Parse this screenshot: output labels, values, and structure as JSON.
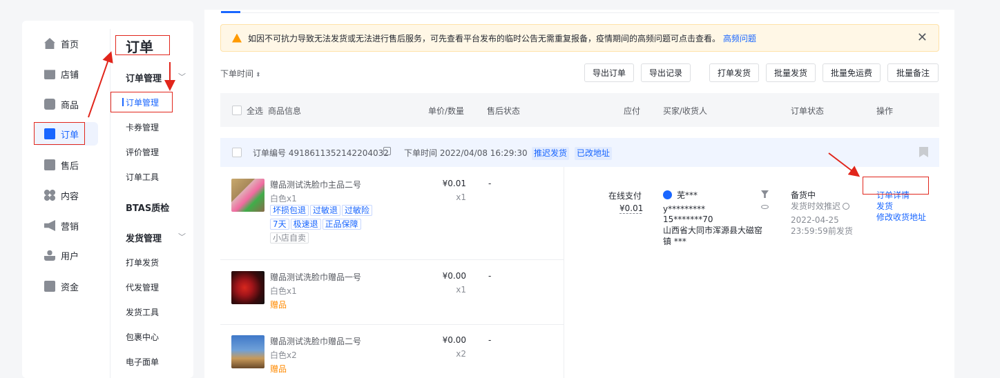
{
  "nav_primary": {
    "items": [
      {
        "label": "首页",
        "icon": "home-icon"
      },
      {
        "label": "店铺",
        "icon": "shop-icon"
      },
      {
        "label": "商品",
        "icon": "product-icon"
      },
      {
        "label": "订单",
        "icon": "order-icon",
        "active": true
      },
      {
        "label": "售后",
        "icon": "aftersale-icon"
      },
      {
        "label": "内容",
        "icon": "content-icon"
      },
      {
        "label": "营销",
        "icon": "marketing-icon"
      },
      {
        "label": "用户",
        "icon": "user-icon"
      },
      {
        "label": "资金",
        "icon": "wallet-icon"
      }
    ]
  },
  "nav_secondary": {
    "title": "订单",
    "groups": [
      {
        "label": "订单管理",
        "items": [
          "订单管理",
          "卡券管理",
          "评价管理",
          "订单工具"
        ]
      },
      {
        "label": "BTAS质检",
        "items": []
      },
      {
        "label": "发货管理",
        "items": [
          "打单发货",
          "代发管理",
          "发货工具",
          "包裹中心",
          "电子面单"
        ]
      }
    ]
  },
  "notice": {
    "text": "如因不可抗力导致无法发货或无法进行售后服务，可先查看平台发布的临时公告无需重复报备，疫情期间的高频问题可点击查看。",
    "link": "高频问题"
  },
  "toolbar": {
    "sort_label": "下单时间",
    "buttons": [
      "导出订单",
      "导出记录",
      "打单发货",
      "批量发货",
      "批量免运费",
      "批量备注"
    ]
  },
  "table_header": {
    "select_all": "全选",
    "columns": [
      "商品信息",
      "单价/数量",
      "售后状态",
      "应付",
      "买家/收货人",
      "订单状态",
      "操作"
    ]
  },
  "order": {
    "number_text": "订单编号 4918611352142204032",
    "time_text": "下单时间 2022/04/08 16:29:30",
    "tags": [
      "推迟发货",
      "已改地址"
    ],
    "products": [
      {
        "name": "赠品测试洗脸巾主品二号",
        "spec": "白色x1",
        "tags": [
          "坏损包退",
          "过敏退",
          "过敏险",
          "7天",
          "极速退",
          "正品保障"
        ],
        "store_tag": "小店自卖",
        "price": "¥0.01",
        "qty": "x1",
        "aftersale": "-"
      },
      {
        "name": "赠品测试洗脸巾赠品一号",
        "spec": "白色x1",
        "gift": "赠品",
        "price": "¥0.00",
        "qty": "x1",
        "aftersale": "-"
      },
      {
        "name": "赠品测试洗脸巾赠品二号",
        "spec": "白色x2",
        "gift": "赠品",
        "price": "¥0.00",
        "qty": "x2",
        "aftersale": "-"
      }
    ],
    "payment": {
      "method": "在线支付",
      "amount": "¥0.01"
    },
    "buyer": {
      "name": "芜***",
      "masked_id": "y*********",
      "phone": "15*******70",
      "address_1": "山西省大同市浑源县大磁窑",
      "address_2": "镇 ***"
    },
    "status": {
      "main": "备货中",
      "sub": "发货时效推迟",
      "date": "2022-04-25",
      "deadline": "23:59:59前发货"
    },
    "actions": [
      "订单详情",
      "发货",
      "修改收货地址"
    ]
  },
  "colors": {
    "accent": "#1966ff",
    "annotation_red": "#e1251b",
    "gift_orange": "#ff8a00",
    "notice_bg": "#fff7e6"
  }
}
